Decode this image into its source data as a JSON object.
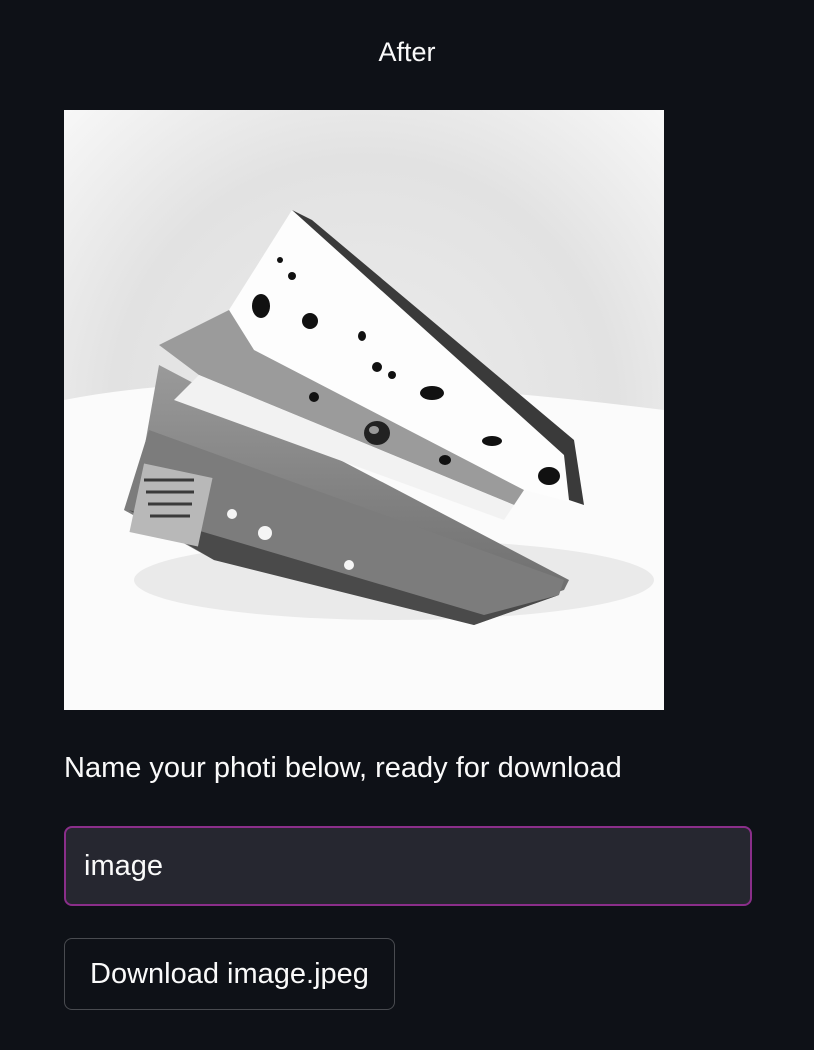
{
  "after_section": {
    "caption": "After"
  },
  "image": {
    "icon": "cheese-photo",
    "style": "inverted grayscale"
  },
  "rename_section": {
    "label": "Name your photi below, ready for download",
    "input_value": "image"
  },
  "download": {
    "button_label": "Download image.jpeg"
  },
  "colors": {
    "background": "#0e1117",
    "input_background": "#262730",
    "input_border_focus": "#8a2e8a",
    "text": "#fafafa"
  }
}
